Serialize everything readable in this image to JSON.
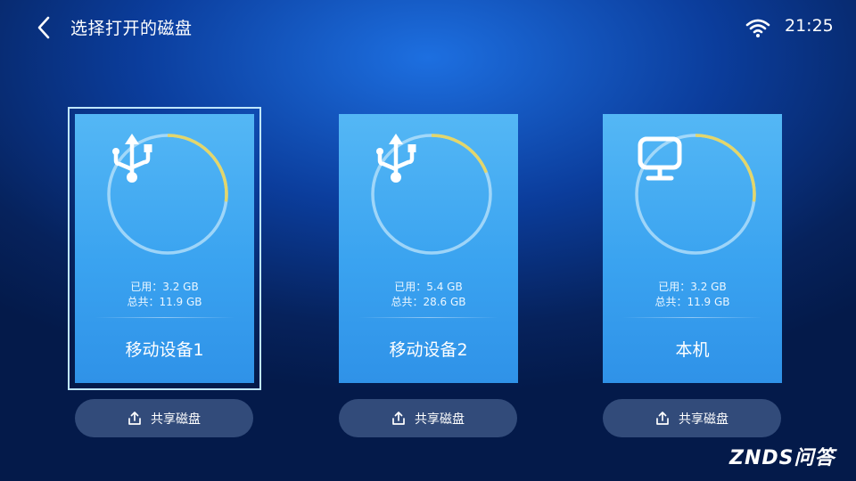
{
  "header": {
    "title": "选择打开的磁盘",
    "time": "21:25"
  },
  "icons": {
    "back": "chevron-left-icon",
    "wifi": "wifi-icon",
    "usb": "usb-icon",
    "computer": "monitor-icon",
    "share": "share-icon"
  },
  "colors": {
    "card": "#3aa3f0",
    "ring_track": "#bde4fb",
    "ring_used": "#e3d66b"
  },
  "devices": [
    {
      "name": "移动设备1",
      "icon": "usb-icon",
      "used_label": "已用：",
      "used": "3.2 GB",
      "total_label": "总共：",
      "total": "11.9 GB",
      "usage_fraction": 0.27,
      "share_label": "共享磁盘",
      "selected": true
    },
    {
      "name": "移动设备2",
      "icon": "usb-icon",
      "used_label": "已用：",
      "used": "5.4 GB",
      "total_label": "总共：",
      "total": "28.6 GB",
      "usage_fraction": 0.19,
      "share_label": "共享磁盘",
      "selected": false
    },
    {
      "name": "本机",
      "icon": "monitor-icon",
      "used_label": "已用：",
      "used": "3.2 GB",
      "total_label": "总共：",
      "total": "11.9 GB",
      "usage_fraction": 0.27,
      "share_label": "共享磁盘",
      "selected": false
    }
  ],
  "watermark": {
    "text": "ZNDS问答"
  }
}
